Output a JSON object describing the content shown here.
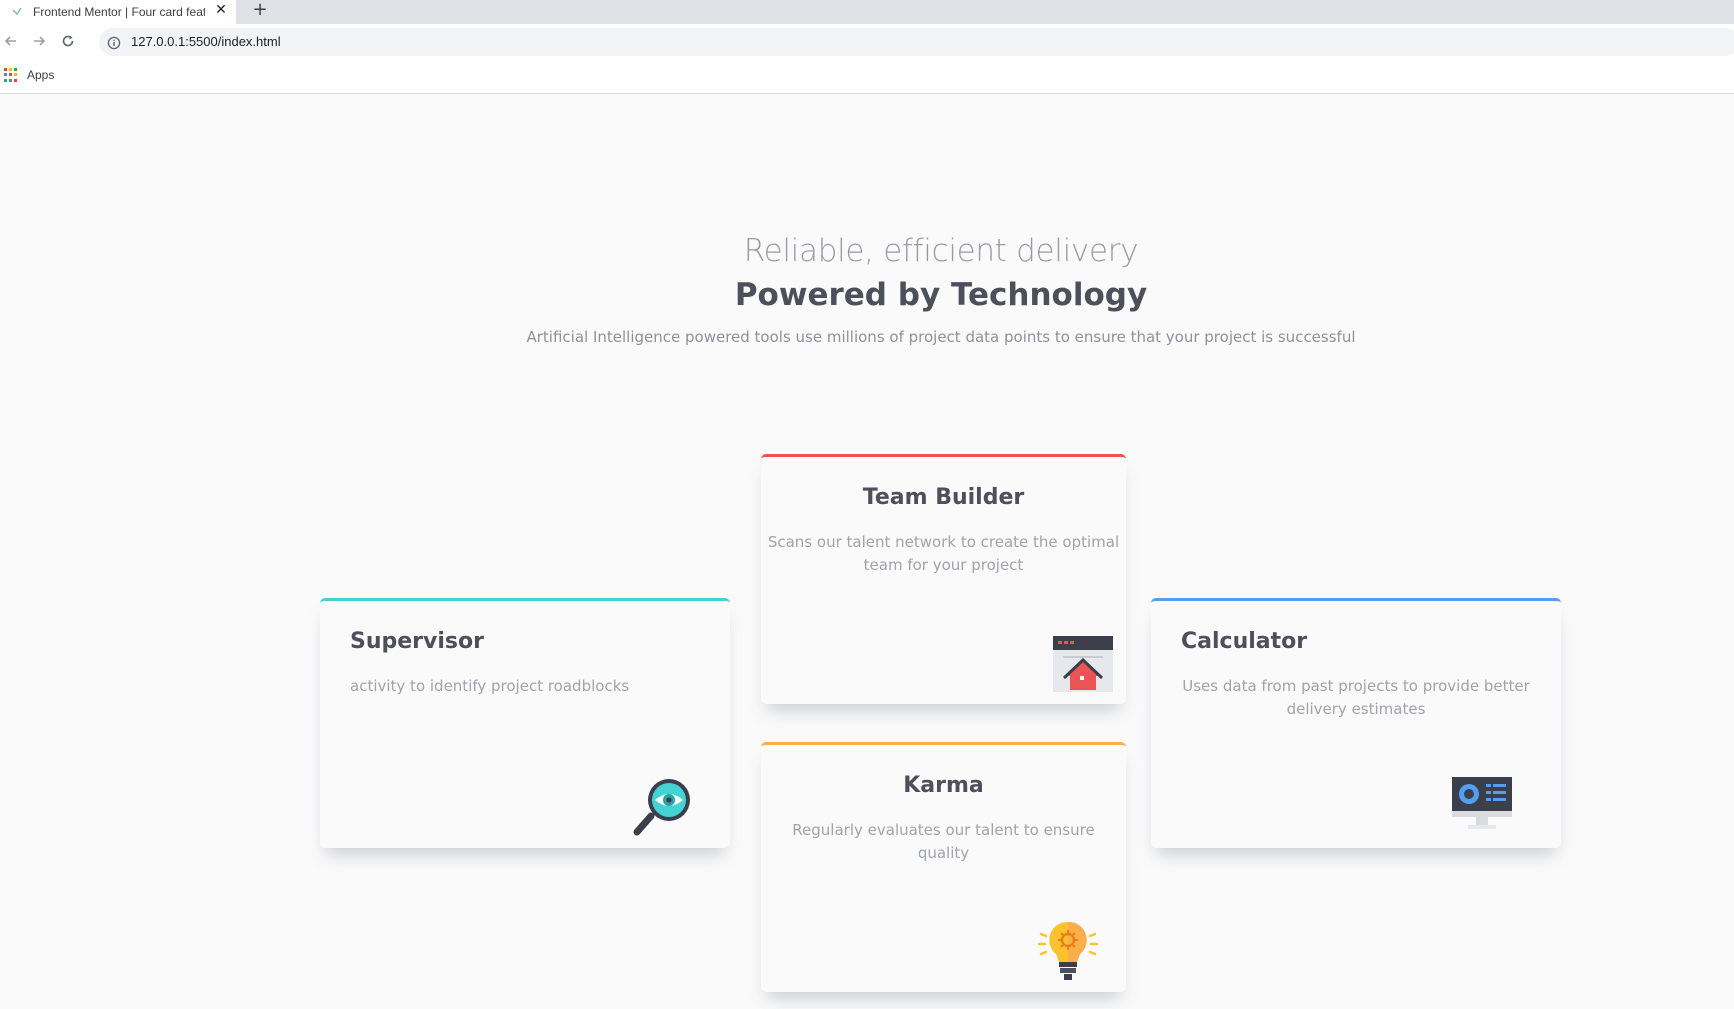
{
  "browser": {
    "tab_title": "Frontend Mentor | Four card feature section",
    "tab_close": "✕",
    "new_tab": "+",
    "url": "127.0.0.1:5500/index.html",
    "bookmarks_apps_label": "Apps"
  },
  "hero": {
    "subtitle": "Reliable, efficient delivery",
    "title": "Powered by Technology",
    "description": "Artificial Intelligence powered tools use millions of project data points to ensure that your project is successful"
  },
  "cards": {
    "team_builder": {
      "title": "Team Builder",
      "description": "Scans our talent network to create the optimal team for your project",
      "icon": "team-builder-icon",
      "accent": "#ea5454"
    },
    "supervisor": {
      "title": "Supervisor",
      "description": "activity to identify project roadblocks",
      "icon": "supervisor-magnifier-icon",
      "accent": "#44d3d2"
    },
    "calculator": {
      "title": "Calculator",
      "description": "Uses data from past projects to provide better delivery estimates",
      "icon": "calculator-monitor-icon",
      "accent": "#549ef2"
    },
    "karma": {
      "title": "Karma",
      "description": "Regularly evaluates our talent to ensure quality",
      "icon": "karma-lightbulb-icon",
      "accent": "#fcae4a"
    }
  }
}
